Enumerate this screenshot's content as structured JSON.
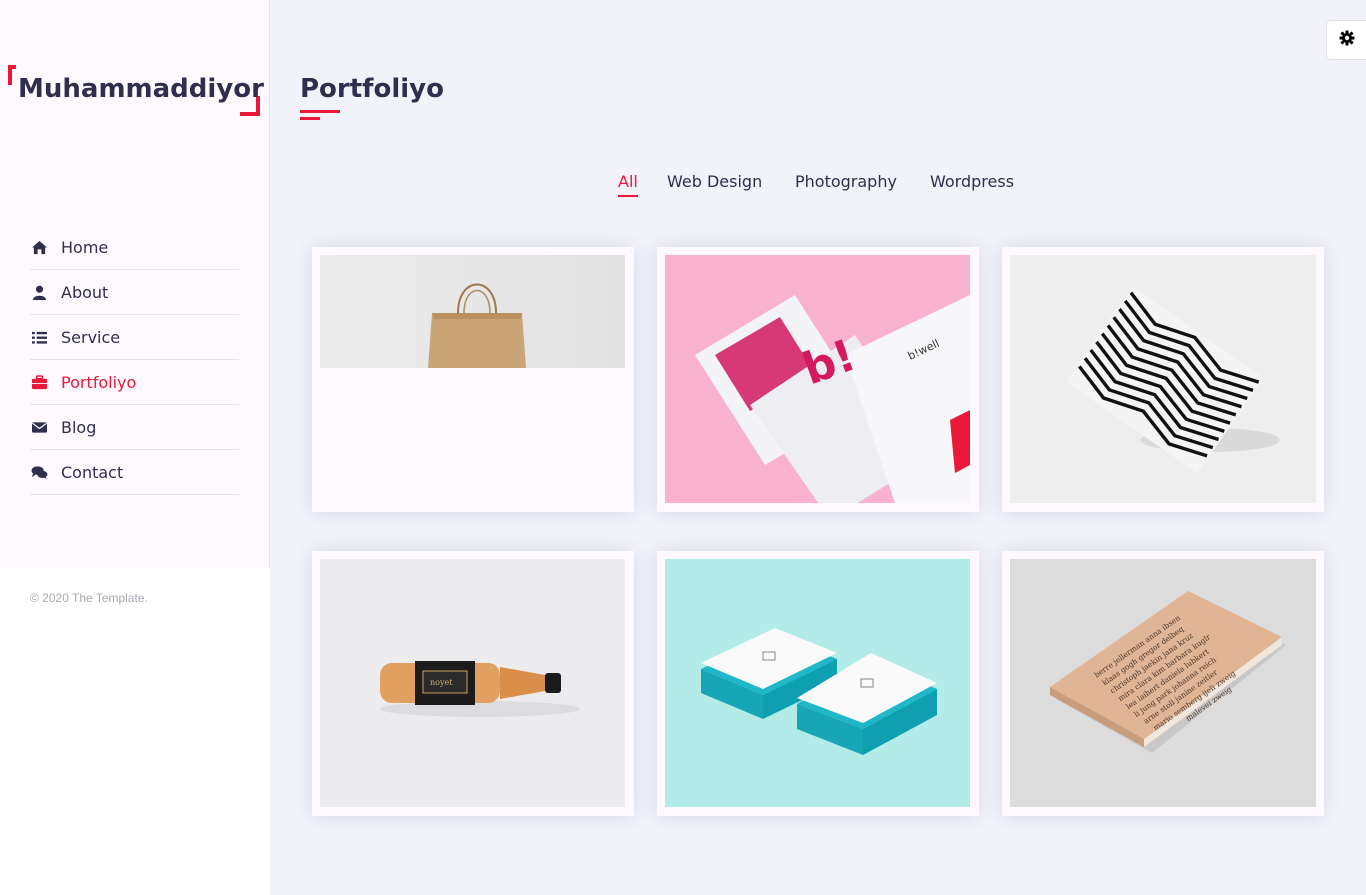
{
  "sidebar": {
    "logo": "Muhammaddiyor",
    "items": [
      {
        "label": "Home",
        "icon": "home-icon"
      },
      {
        "label": "About",
        "icon": "user-icon"
      },
      {
        "label": "Service",
        "icon": "list-icon"
      },
      {
        "label": "Portfoliyo",
        "icon": "briefcase-icon",
        "active": true
      },
      {
        "label": "Blog",
        "icon": "envelope-icon"
      },
      {
        "label": "Contact",
        "icon": "comments-icon"
      }
    ],
    "copyright": "© 2020 The Template."
  },
  "main": {
    "title": "Portfoliyo",
    "filters": [
      "All",
      "Web Design",
      "Photography",
      "Wordpress"
    ],
    "active_filter": "All",
    "items": [
      {
        "image": "paper-shopping-bag"
      },
      {
        "image": "pink-branding-cards"
      },
      {
        "image": "zigzag-pattern-paper"
      },
      {
        "image": "amber-glass-bottle"
      },
      {
        "image": "turquoise-business-cards"
      },
      {
        "image": "book-cover-typography"
      }
    ]
  },
  "settings": {
    "icon": "gear-icon"
  },
  "colors": {
    "accent": "#ec1839",
    "text": "#302e4d",
    "background": "#f1f2fa",
    "sidebar": "#fdf9ff"
  }
}
